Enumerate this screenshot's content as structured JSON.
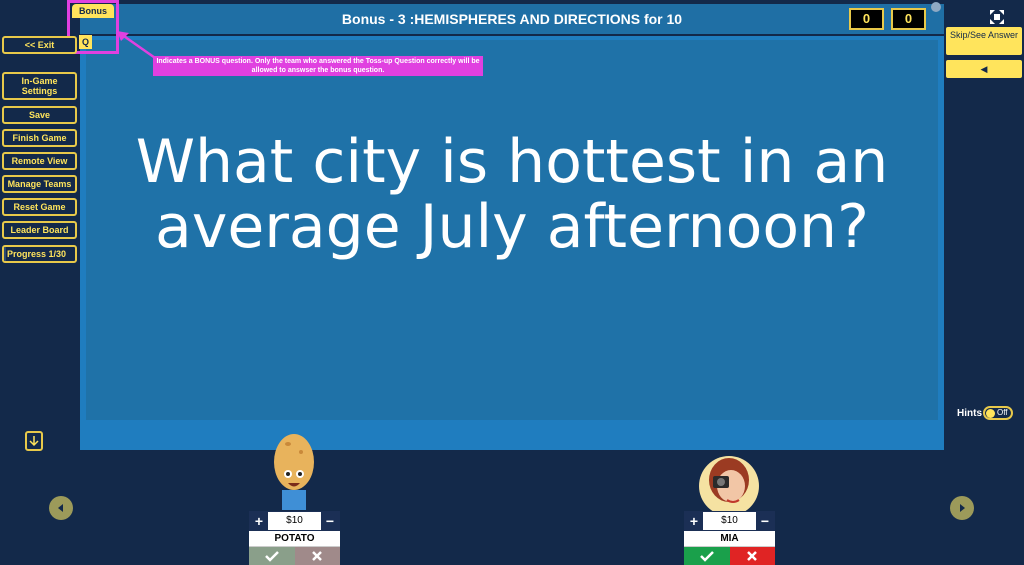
{
  "header": {
    "title": "Bonus - 3 :HEMISPHERES AND DIRECTIONS for 10",
    "bonus_badge": "Bonus",
    "q_badge": "Q",
    "scores": [
      "0",
      "0"
    ]
  },
  "sidebar": {
    "exit": "<< Exit",
    "in_game_settings": "In-Game Settings",
    "save": "Save",
    "finish_game": "Finish Game",
    "remote_view": "Remote View",
    "manage_teams": "Manage Teams",
    "reset_game": "Reset Game",
    "leader_board": "Leader Board",
    "progress_label": "Progress 1/30",
    "progress_fraction": 0.033
  },
  "annotation": {
    "text": "Indicates a BONUS question. Only the team who answered the Toss-up Question correctly will be allowed to answser the bonus question."
  },
  "question": {
    "text": "What city is hottest in an average July afternoon?"
  },
  "right_panel": {
    "skip_label": "Skip/See Answer",
    "sound_icon": "speaker-icon",
    "hints_label": "Hints",
    "hints_state": "Off"
  },
  "teams": [
    {
      "name": "POTATO",
      "score": "$10",
      "avatar": "potato-avatar"
    },
    {
      "name": "MIA",
      "score": "$10",
      "avatar": "girl-camera-avatar"
    }
  ],
  "colors": {
    "background": "#13294a",
    "panel": "#1f7dbf",
    "accent": "#ffe45c",
    "annotation": "#e040e0"
  }
}
